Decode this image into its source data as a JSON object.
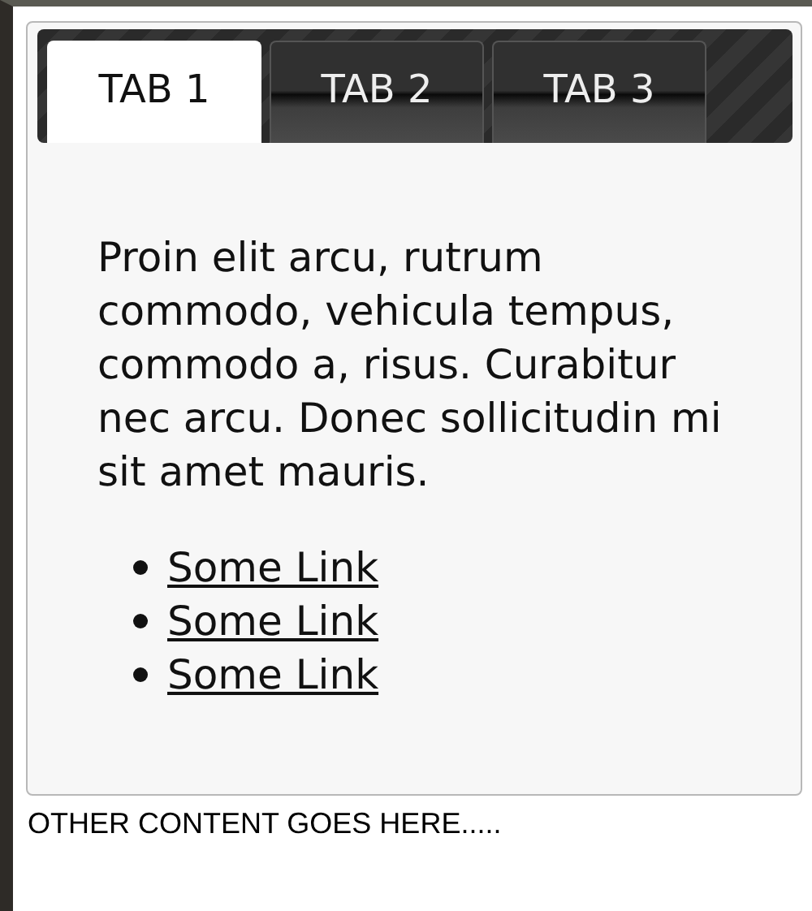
{
  "tabs": [
    {
      "label": "TAB 1",
      "selected": true
    },
    {
      "label": "TAB 2",
      "selected": false
    },
    {
      "label": "TAB 3",
      "selected": false
    }
  ],
  "panel": {
    "paragraph": "Proin elit arcu, rutrum commodo, vehicula tempus, commodo a, risus. Curabitur nec arcu. Donec sollicitudin mi sit amet mauris.",
    "links": [
      "Some Link",
      "Some Link",
      "Some Link"
    ]
  },
  "footer_text": "OTHER CONTENT GOES HERE....."
}
